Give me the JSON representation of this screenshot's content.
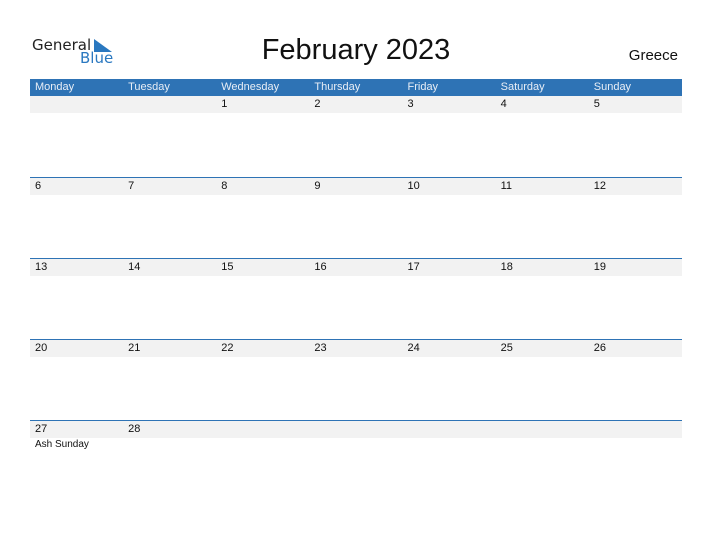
{
  "logo": {
    "general": "General",
    "blue": "Blue"
  },
  "title": "February 2023",
  "country": "Greece",
  "weekdays": [
    "Monday",
    "Tuesday",
    "Wednesday",
    "Thursday",
    "Friday",
    "Saturday",
    "Sunday"
  ],
  "weeks": [
    [
      "",
      "",
      "1",
      "2",
      "3",
      "4",
      "5"
    ],
    [
      "6",
      "7",
      "8",
      "9",
      "10",
      "11",
      "12"
    ],
    [
      "13",
      "14",
      "15",
      "16",
      "17",
      "18",
      "19"
    ],
    [
      "20",
      "21",
      "22",
      "23",
      "24",
      "25",
      "26"
    ],
    [
      "27",
      "28",
      "",
      "",
      "",
      "",
      ""
    ]
  ],
  "events": [
    {
      "date": "27",
      "label": "Ash Sunday"
    }
  ]
}
